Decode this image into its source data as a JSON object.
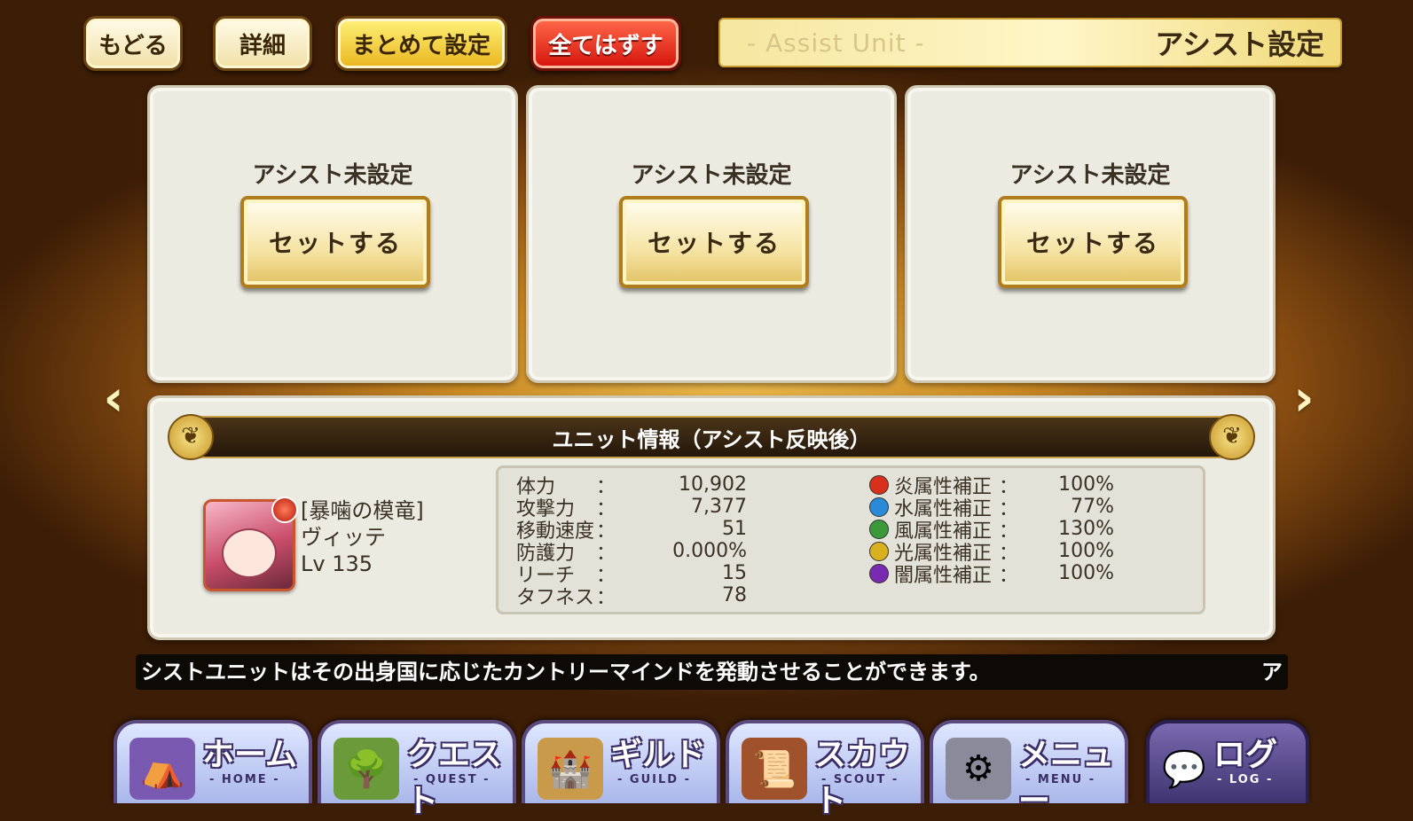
{
  "toolbar": {
    "back_label": "もどる",
    "detail_label": "詳細",
    "bulk_set_label": "まとめて設定",
    "remove_all_label": "全てはずす"
  },
  "title": {
    "subtitle": "- Assist Unit -",
    "main": "アシスト設定"
  },
  "slots": [
    {
      "status": "アシスト未設定",
      "button": "セットする"
    },
    {
      "status": "アシスト未設定",
      "button": "セットする"
    },
    {
      "status": "アシスト未設定",
      "button": "セットする"
    }
  ],
  "nav_arrows": {
    "left": "left-arrow-icon",
    "right": "right-arrow-icon"
  },
  "unit_info": {
    "header": "ユニット情報（アシスト反映後）",
    "unit_title": "[暴噛の模竜]",
    "unit_name": "ヴィッテ",
    "unit_level": "Lv 135",
    "stats": [
      {
        "name": "体力",
        "value": "10,902"
      },
      {
        "name": "攻撃力",
        "value": "7,377"
      },
      {
        "name": "移動速度",
        "value": "51"
      },
      {
        "name": "防護力",
        "value": "0.000%"
      },
      {
        "name": "リーチ",
        "value": "15"
      },
      {
        "name": "タフネス",
        "value": "78"
      }
    ],
    "element_mods": [
      {
        "name": "炎属性補正",
        "value": "100%",
        "color": "#d8301a"
      },
      {
        "name": "水属性補正",
        "value": "77%",
        "color": "#2a8ad8"
      },
      {
        "name": "風属性補正",
        "value": "130%",
        "color": "#3a9a3a"
      },
      {
        "name": "光属性補正",
        "value": "100%",
        "color": "#d8b020"
      },
      {
        "name": "闇属性補正",
        "value": "100%",
        "color": "#7a2ab0"
      }
    ]
  },
  "ticker": {
    "text": "シストユニットはその出身国に応じたカントリーマインドを発動させることができます。",
    "tail": "ア"
  },
  "bottom_nav": [
    {
      "label": "ホーム",
      "sub": "- HOME -"
    },
    {
      "label": "クエスト",
      "sub": "- QUEST -"
    },
    {
      "label": "ギルド",
      "sub": "- GUILD -"
    },
    {
      "label": "スカウト",
      "sub": "- SCOUT -"
    },
    {
      "label": "メニュー",
      "sub": "- MENU -"
    },
    {
      "label": "ログ",
      "sub": "- LOG -"
    }
  ]
}
